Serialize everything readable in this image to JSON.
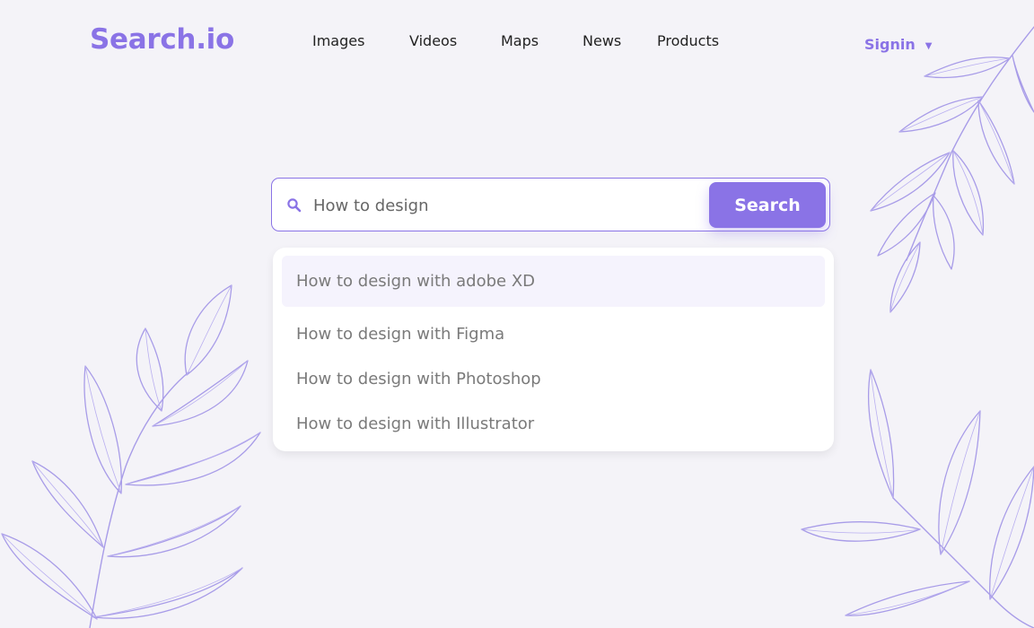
{
  "brand": {
    "logo": "Search.io",
    "accent": "#8a73e6"
  },
  "nav": {
    "items": [
      {
        "label": "Images"
      },
      {
        "label": "Videos"
      },
      {
        "label": "Maps"
      },
      {
        "label": "News"
      },
      {
        "label": "Products"
      }
    ],
    "signin_label": "Signin",
    "signin_caret": "▼"
  },
  "search": {
    "value": "",
    "placeholder": "How to design",
    "button_label": "Search",
    "icon": "search-icon"
  },
  "suggestions": [
    {
      "label": "How to design with adobe XD",
      "highlighted": true
    },
    {
      "label": "How to design with Figma",
      "highlighted": false
    },
    {
      "label": "How to design with Photoshop",
      "highlighted": false
    },
    {
      "label": "How to design with Illustrator",
      "highlighted": false
    }
  ]
}
